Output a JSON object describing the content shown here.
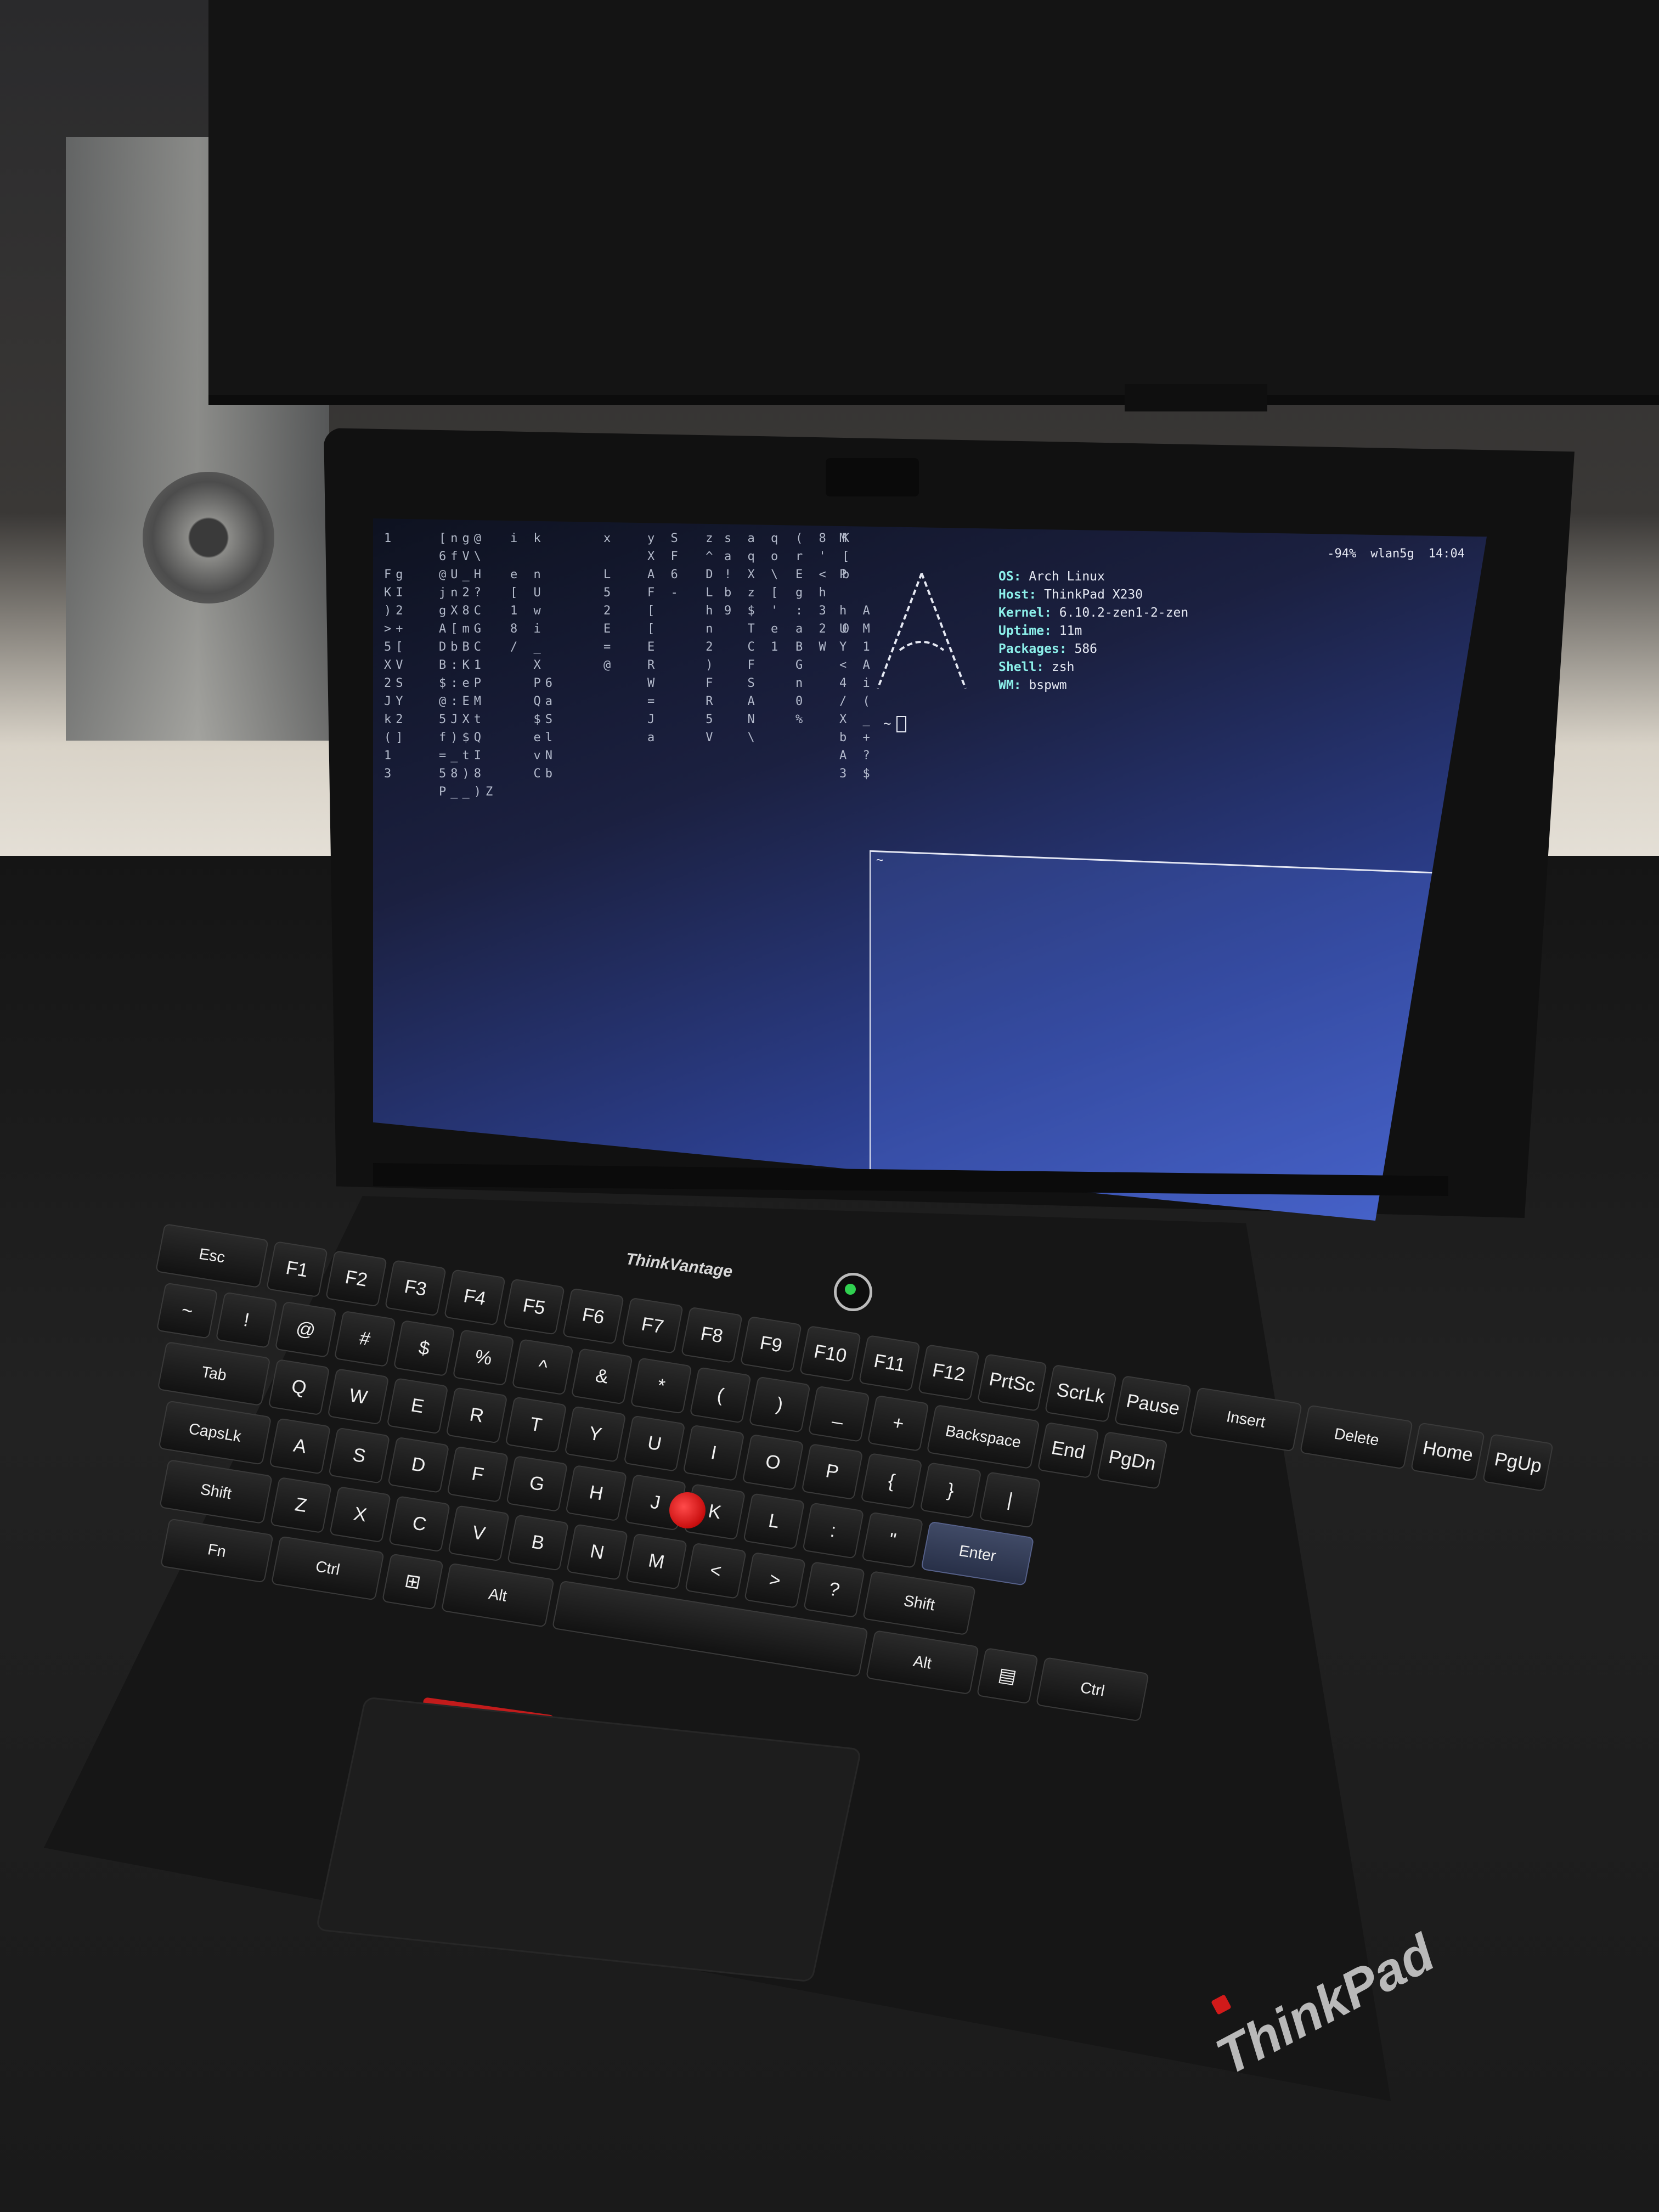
{
  "screen": {
    "status": {
      "battery": "-94%",
      "network": "wlan5g",
      "clock": "14:04"
    },
    "fetch": [
      {
        "key": "OS:",
        "value": "Arch Linux"
      },
      {
        "key": "Host:",
        "value": "ThinkPad X230"
      },
      {
        "key": "Kernel:",
        "value": "6.10.2-zen1-2-zen"
      },
      {
        "key": "Uptime:",
        "value": "11m"
      },
      {
        "key": "Packages:",
        "value": "586"
      },
      {
        "key": "Shell:",
        "value": "zsh"
      },
      {
        "key": "WM:",
        "value": "bspwm"
      }
    ],
    "prompt": "~",
    "pane_prompt": "~",
    "matrix_columns": [
      "1\n\nFg\nKI\n)2\n>+\n5[\nXV\n2S\nJY\nk2\n(]\n1\n3",
      "[ng@\n6fV\\\n@U_H\njn2?\ngX8C\nA[mG\nDbBC\nB:K1\n$:eP\n@:EM\n5JXt\nf)$Q\n=_tI\n58)8\nP__)Z",
      "i k\n\ne n\n[ U\n1 w\n8 i\n/ _\n  X\n  P6\n  Qa\n  $S\n  el\n  vN\n  Cb",
      "x\n\nL\n5\n2\nE\n=\n@",
      "y S  z\nX F  ^\nA 6  D\nF -  L\n[    h\n[    n\nE    2\nR    )\nW    F\n=    R\nJ    5\na    V",
      "s a q\na q o\n! X \\\nb z [\n9 $ '\n  T e\n  C 1\n  F\n  S\n  A\n  N\n  \\",
      "( 8 K\nr ' [\nE < b\ng h\n: 3\na 2 0\nB W\nG\nn\n0\n%",
      "M\n\nP\n\nh A\nU M\nY 1\n< A\n4 i\n/ (\nX _\nb +\nA ?\n3 $"
    ]
  },
  "keyboard": {
    "rows": [
      [
        "Esc",
        "F1",
        "F2",
        "F3",
        "F4",
        "F5",
        "F6",
        "F7",
        "F8",
        "F9",
        "F10",
        "F11",
        "F12",
        "PrtSc",
        "ScrLk",
        "Pause",
        "Insert",
        "Delete",
        "Home",
        "PgUp"
      ],
      [
        "~",
        "!",
        "@",
        "#",
        "$",
        "%",
        "^",
        "&",
        "*",
        "(",
        ")",
        "_",
        "+",
        "Backspace",
        "End",
        "PgDn"
      ],
      [
        "Tab",
        "Q",
        "W",
        "E",
        "R",
        "T",
        "Y",
        "U",
        "I",
        "O",
        "P",
        "{",
        "}",
        "|"
      ],
      [
        "CapsLk",
        "A",
        "S",
        "D",
        "F",
        "G",
        "H",
        "J",
        "K",
        "L",
        ":",
        "\"",
        "Enter"
      ],
      [
        "Shift",
        "Z",
        "X",
        "C",
        "V",
        "B",
        "N",
        "M",
        "<",
        ">",
        "?",
        "Shift"
      ],
      [
        "Fn",
        "Ctrl",
        "⊞",
        "Alt",
        "",
        "Alt",
        "▤",
        "Ctrl"
      ]
    ],
    "thinkvantage": "ThinkVantage"
  },
  "branding": {
    "logo": "ThinkPad"
  }
}
